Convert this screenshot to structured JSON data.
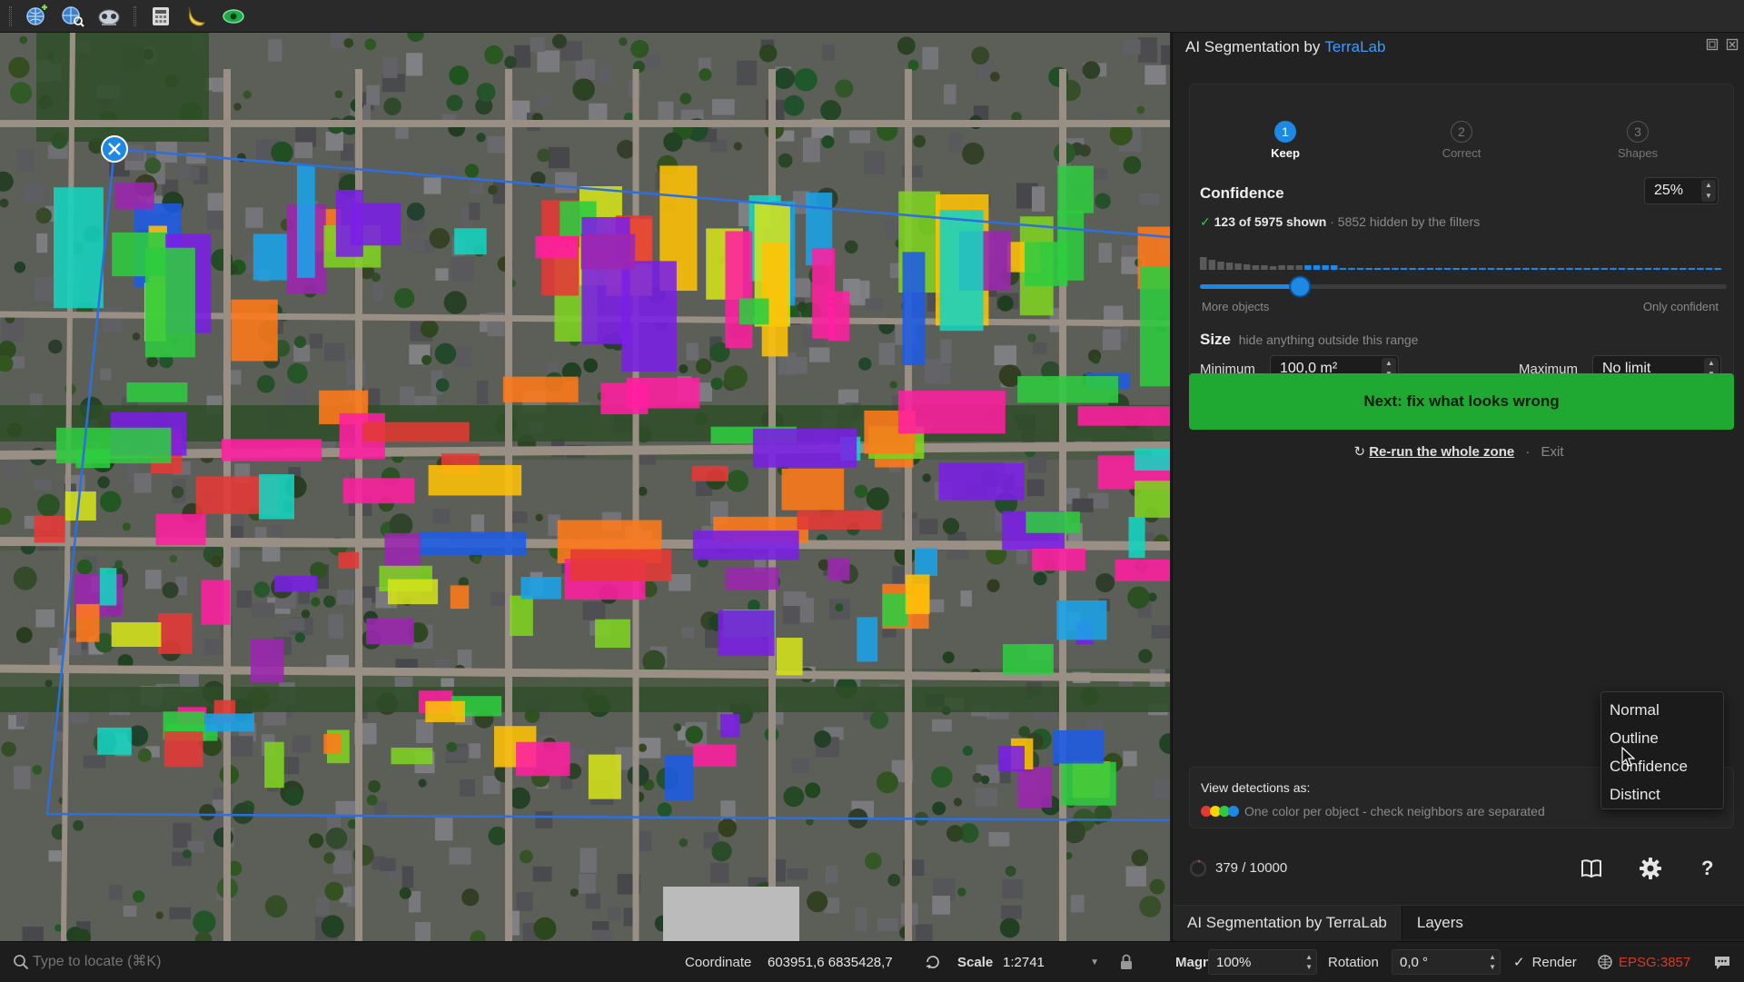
{
  "toolbar": {
    "icons": [
      "add-globe-icon",
      "search-globe-icon",
      "model-icon",
      "calculator-icon",
      "banana-icon",
      "eye-icon"
    ]
  },
  "panel": {
    "title": "AI Segmentation by",
    "brand": "TerraLab",
    "steps": [
      {
        "num": "1",
        "label": "Keep"
      },
      {
        "num": "2",
        "label": "Correct"
      },
      {
        "num": "3",
        "label": "Shapes"
      }
    ],
    "confidence": {
      "title": "Confidence",
      "value": "25%",
      "shown": "123 of 5975 shown",
      "hidden": "· 5852 hidden by the filters",
      "left_label": "More objects",
      "right_label": "Only confident",
      "slider_fraction": 0.19
    },
    "size": {
      "title": "Size",
      "hint": "hide anything outside this range",
      "min_label": "Minimum",
      "min_value": "100,0 m²",
      "max_label": "Maximum",
      "max_value": "No limit"
    },
    "next_button": "Next: fix what looks wrong",
    "rerun": "Re-run the whole zone",
    "exit": "Exit",
    "view": {
      "label": "View detections as:",
      "description": "One color per object - check neighbors are separated",
      "colors": [
        "#e53935",
        "#ffd400",
        "#2ecc40",
        "#1e88e5"
      ]
    },
    "dropdown": [
      "Normal",
      "Outline",
      "Confidence",
      "Distinct"
    ],
    "progress": "379 / 10000",
    "tabs": [
      "AI Segmentation by TerraLab",
      "Layers"
    ]
  },
  "status": {
    "search_placeholder": "Type to locate (⌘K)",
    "coordinate_label": "Coordinate",
    "coordinate_value": "603951,6  6835428,7",
    "scale_label": "Scale",
    "scale_value": "1:2741",
    "magnifier_label": "Magnifier",
    "magnifier_value": "100%",
    "rotation_label": "Rotation",
    "rotation_value": "0,0 °",
    "render_label": "Render",
    "crs": "EPSG:3857"
  }
}
